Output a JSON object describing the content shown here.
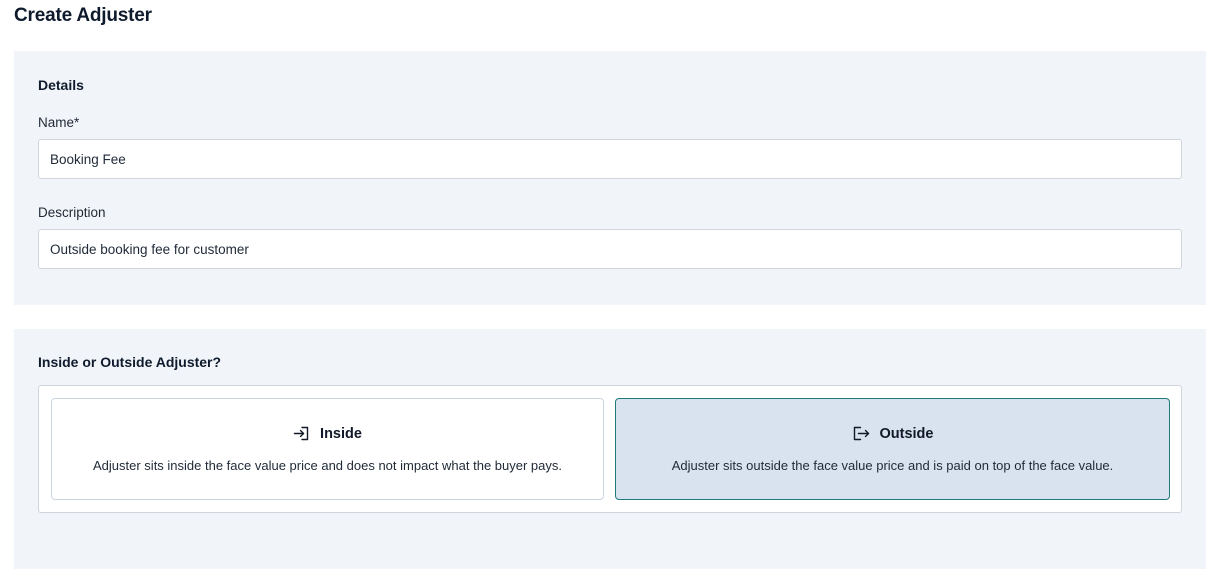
{
  "page": {
    "title": "Create Adjuster"
  },
  "details": {
    "title": "Details",
    "name": {
      "label": "Name*",
      "value": "Booking Fee"
    },
    "description": {
      "label": "Description",
      "value": "Outside booking fee for customer"
    }
  },
  "adjuster_type": {
    "title": "Inside or Outside Adjuster?",
    "selected": "Outside",
    "options": [
      {
        "label": "Inside",
        "icon": "sign-in-icon",
        "description": "Adjuster sits inside the face value price and does not impact what the buyer pays."
      },
      {
        "label": "Outside",
        "icon": "sign-out-icon",
        "description": "Adjuster sits outside the face value price and is paid on top of the face value."
      }
    ]
  },
  "colors": {
    "panel_bg": "#f1f5f9",
    "selected_bg": "#d8e3ef",
    "selected_border": "#1f7a7a"
  }
}
